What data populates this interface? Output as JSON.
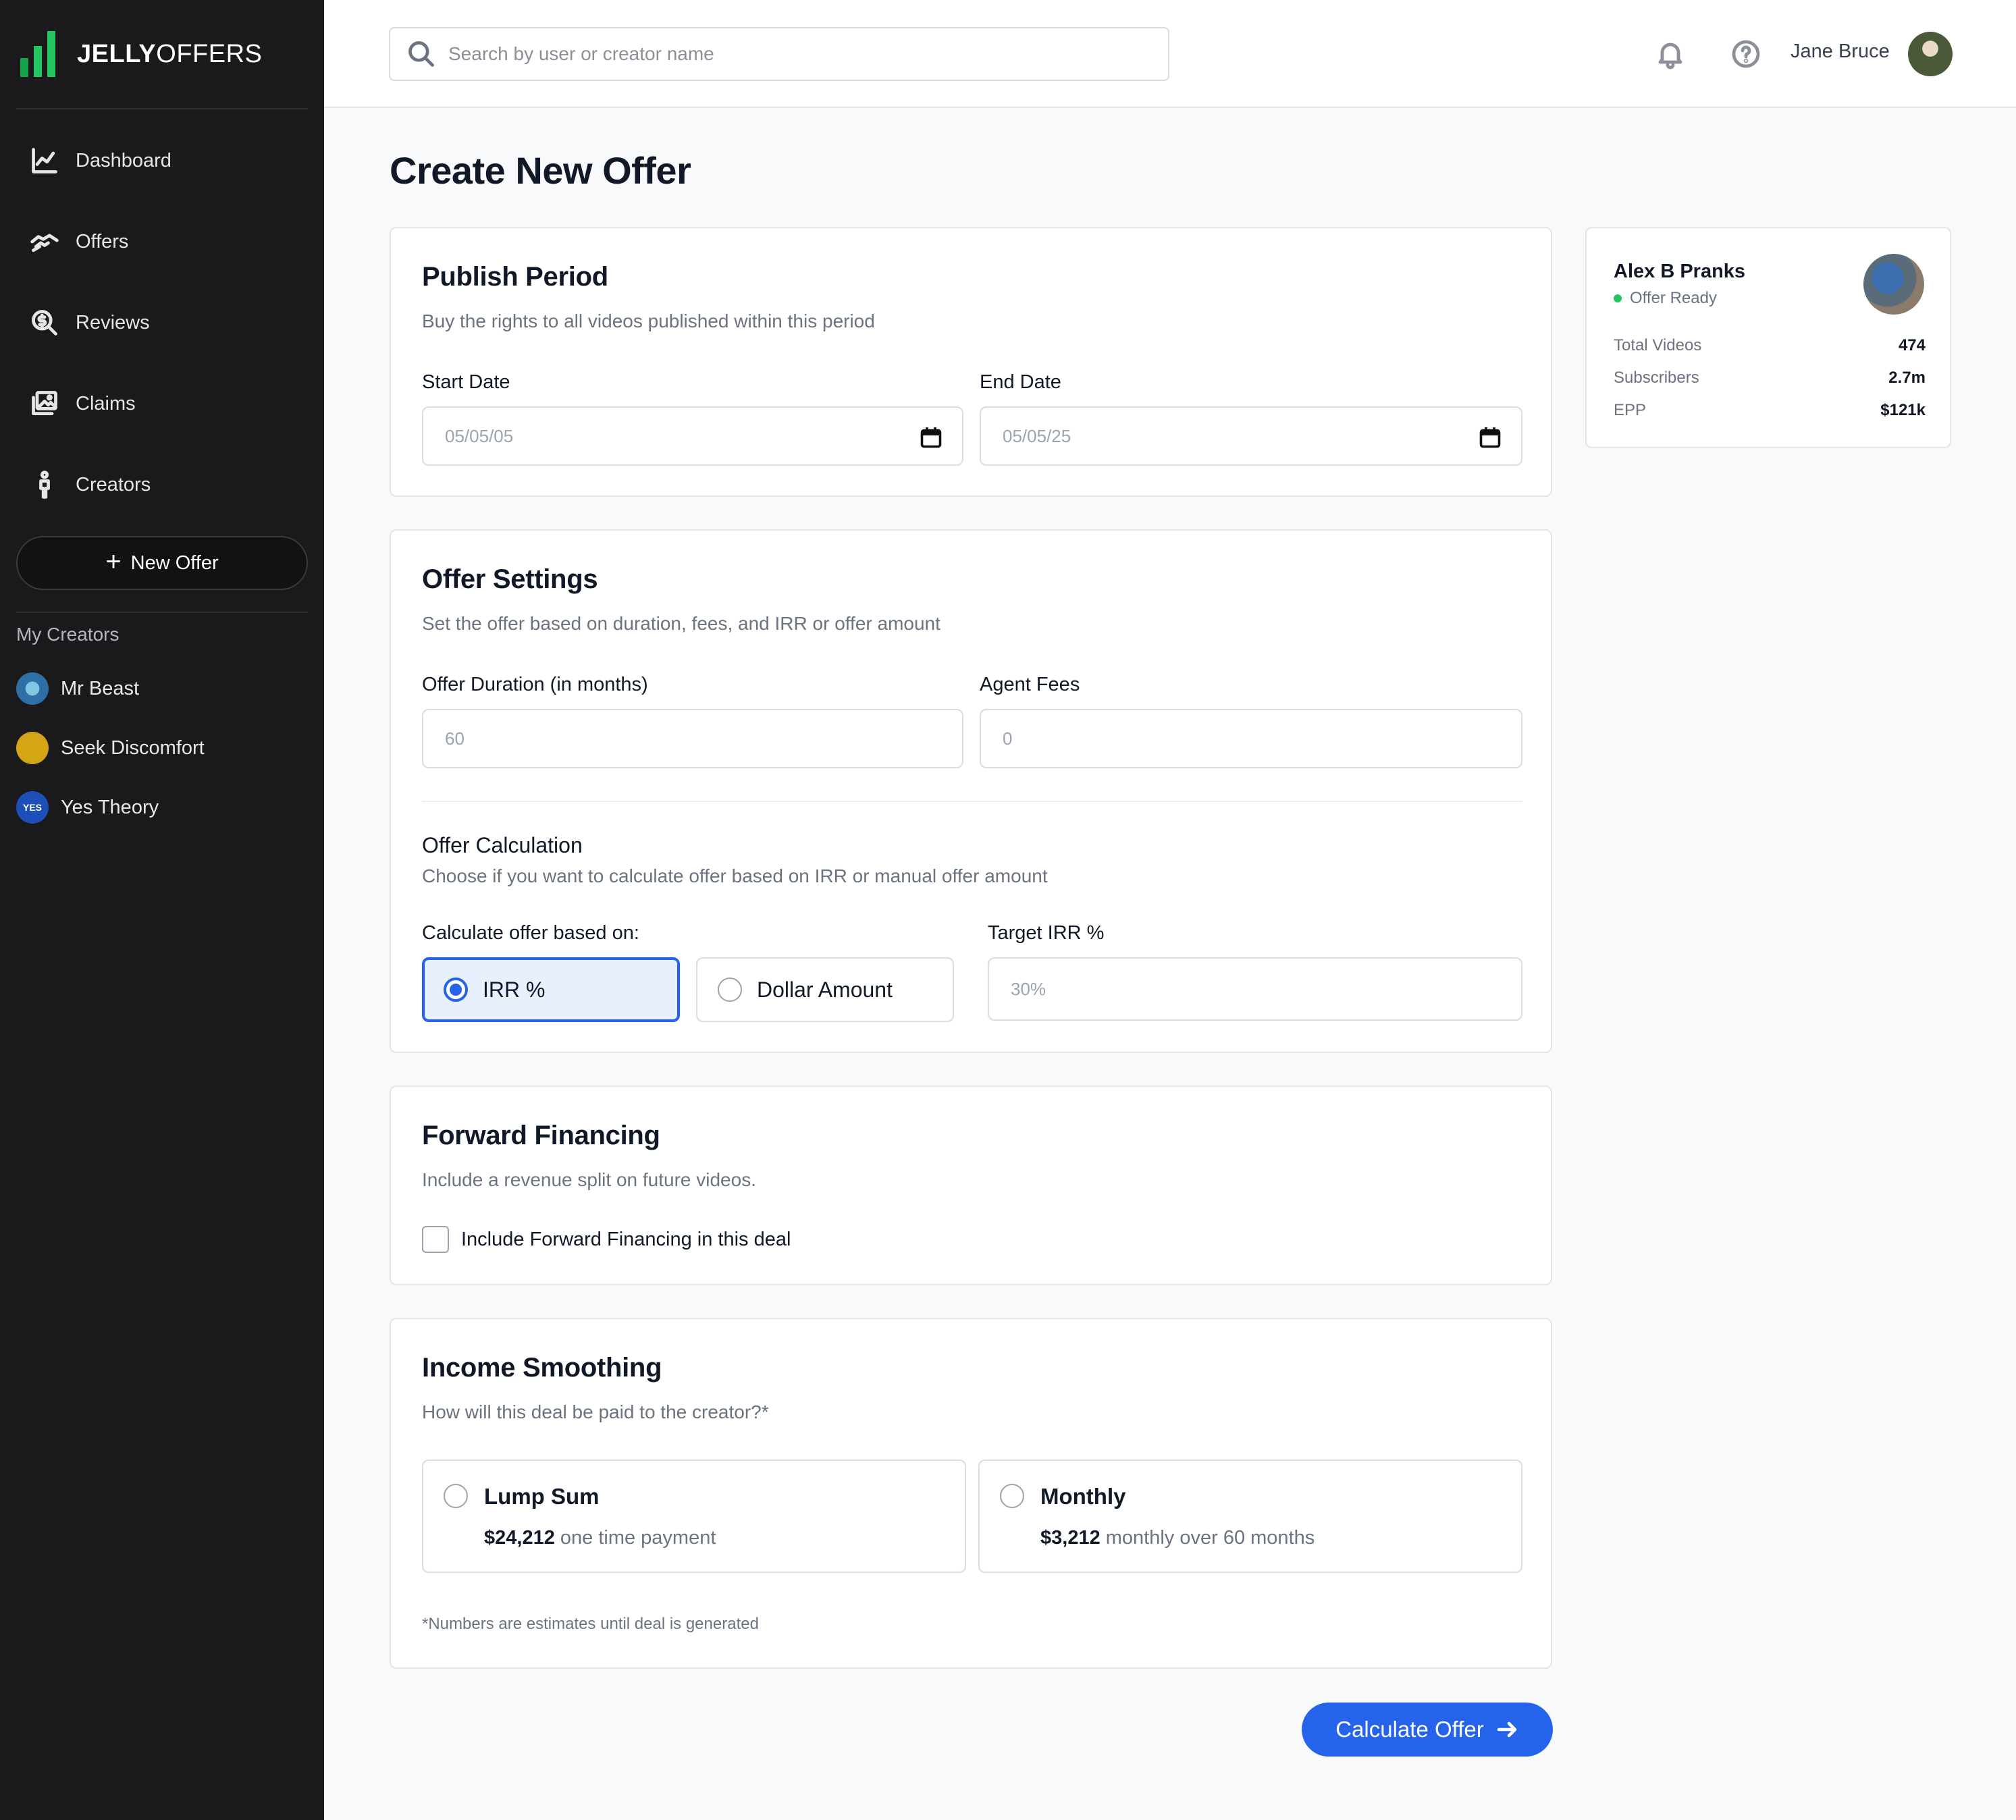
{
  "brand": {
    "bold": "JELLY",
    "regular": "OFFERS",
    "logo_icon": "bar-chart-logo-icon",
    "logo_color": "#22c55e"
  },
  "sidebar": {
    "nav": [
      {
        "label": "Dashboard",
        "icon": "line-chart-icon"
      },
      {
        "label": "Offers",
        "icon": "handshake-icon"
      },
      {
        "label": "Reviews",
        "icon": "dollar-search-icon"
      },
      {
        "label": "Claims",
        "icon": "images-icon"
      },
      {
        "label": "Creators",
        "icon": "person-icon"
      }
    ],
    "new_offer_label": "New Offer",
    "my_creators_label": "My Creators",
    "creators": [
      {
        "name": "Mr Beast",
        "avatar_color": "#3b82c4"
      },
      {
        "name": "Seek Discomfort",
        "avatar_color": "#d4a514"
      },
      {
        "name": "Yes Theory",
        "avatar_color": "#1d4fb8",
        "avatar_text": "YES"
      }
    ]
  },
  "header": {
    "search_placeholder": "Search by user or creator name",
    "user_name": "Jane Bruce"
  },
  "main": {
    "title": "Create New Offer",
    "publish_period": {
      "title": "Publish Period",
      "subtitle": "Buy the rights to all videos published within this period",
      "start_label": "Start Date",
      "start_placeholder": "05/05/05",
      "end_label": "End Date",
      "end_placeholder": "05/05/25"
    },
    "offer_settings": {
      "title": "Offer Settings",
      "subtitle": "Set the offer based on duration, fees, and IRR or offer amount",
      "duration_label": "Offer Duration (in months)",
      "duration_placeholder": "60",
      "fees_label": "Agent Fees",
      "fees_placeholder": "0",
      "calc_title": "Offer Calculation",
      "calc_subtitle": "Choose if you want to calculate offer based on IRR or manual offer amount",
      "based_on_label": "Calculate offer based on:",
      "option_irr": "IRR %",
      "option_dollar": "Dollar Amount",
      "selected": "irr",
      "target_irr_label": "Target IRR %",
      "target_irr_placeholder": "30%"
    },
    "forward_financing": {
      "title": "Forward Financing",
      "subtitle": "Include a revenue split on future videos.",
      "checkbox_label": "Include Forward Financing in this deal",
      "checked": false
    },
    "income_smoothing": {
      "title": "Income Smoothing",
      "subtitle": "How will this deal be paid to the creator?*",
      "lump_title": "Lump Sum",
      "lump_amount": "$24,212",
      "lump_desc": "one time payment",
      "monthly_title": "Monthly",
      "monthly_amount": "$3,212",
      "monthly_desc": "monthly over 60 months",
      "footnote": "*Numbers are estimates until deal is generated"
    },
    "calculate_label": "Calculate Offer"
  },
  "summary": {
    "name": "Alex B Pranks",
    "status": "Offer Ready",
    "status_color": "#22c55e",
    "rows": [
      {
        "k": "Total Videos",
        "v": "474"
      },
      {
        "k": "Subscribers",
        "v": "2.7m"
      },
      {
        "k": "EPP",
        "v": "$121k"
      }
    ]
  },
  "colors": {
    "accent": "#2563eb",
    "sidebar_bg": "#1a1a1c"
  }
}
